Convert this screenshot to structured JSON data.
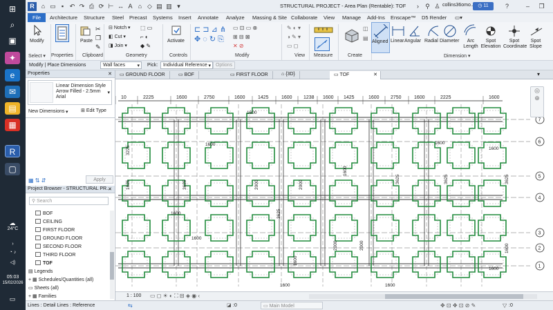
{
  "taskbar": {
    "weather_temp": "24°C",
    "clock_time": "05:03",
    "clock_date": "15/02/2026"
  },
  "title": {
    "window_title": "STRUCTURAL PROJECT - Area Plan (Rentable): TOF",
    "user": "collins36omo...",
    "timer": "11"
  },
  "menu": [
    "File",
    "Architecture",
    "Structure",
    "Steel",
    "Precast",
    "Systems",
    "Insert",
    "Annotate",
    "Analyze",
    "Massing & Site",
    "Collaborate",
    "View",
    "Manage",
    "Add-Ins",
    "Enscape™",
    "D5 Render"
  ],
  "ribbon": {
    "modify": "Modify",
    "paste": "Paste",
    "notch": "Notch",
    "cut": "Cut",
    "join": "Join",
    "activate": "Activate",
    "aligned": "Aligned",
    "linear": "Linear",
    "angular": "Angular",
    "radial": "Radial",
    "diameter": "Diameter",
    "arc_length": "Arc Length",
    "spot_elevation": "Spot Elevation",
    "spot_coordinate": "Spot Coordinate",
    "spot_slope": "Spot Slope",
    "groups": {
      "select": "Select",
      "properties": "Properties",
      "clipboard": "Clipboard",
      "geometry": "Geometry",
      "controls": "Controls",
      "modify": "Modify",
      "view": "View",
      "measure": "Measure",
      "create": "Create",
      "dimension": "Dimension"
    }
  },
  "options_bar": {
    "context": "Modify | Place Dimensions",
    "wall_faces": "Wall faces",
    "pick_label": "Pick:",
    "pick_value": "Individual Reference",
    "options_button": "Options"
  },
  "properties": {
    "header": "Properties",
    "type_name": "Linear Dimension Style Arrow Filled - 2.5mm Arial",
    "instance": "New Dimensions",
    "edit_type": "Edit Type",
    "apply": "Apply"
  },
  "project_browser": {
    "header": "Project Browser - STRUCTURAL PR...",
    "search_placeholder": "Search",
    "views": [
      "BOF",
      "CEILING",
      "FIRST FLOOR",
      "GROUND FLOOR",
      "SECOND FLOOR",
      "THIRD FLOOR",
      "TOF"
    ],
    "other": [
      "Legends",
      "Schedules/Quantities (all)",
      "Sheets (all)",
      "Families"
    ]
  },
  "view_tabs": [
    "GROUND FLOOR",
    "BOF",
    "FIRST FLOOR",
    "{3D}",
    "TOF"
  ],
  "drawing": {
    "top_dims": [
      "10",
      "2225",
      "1600",
      "2750",
      "1600",
      "1425",
      "1600",
      "1238",
      "1600",
      "1425",
      "1600",
      "2750",
      "1600",
      "2225",
      "1600"
    ],
    "gridlines": [
      "7",
      "6",
      "5",
      "4",
      "3",
      "2",
      "1"
    ],
    "inner_dims": [
      "1600",
      "1600",
      "3225",
      "1625",
      "3625",
      "2000",
      "2000",
      "1600",
      "1600",
      "1600",
      "3625",
      "3625",
      "3625",
      "1600",
      "1600",
      "1600",
      "3625",
      "1600",
      "2000",
      "2000",
      "1600",
      "1600",
      "1600"
    ]
  },
  "view_control": {
    "scale": "1 : 100"
  },
  "status": {
    "message": "Lines : Detail Lines : Reference",
    "workset": ":0",
    "model": "Main Model",
    "filter": ":0"
  },
  "colors": {
    "footing": "#1e8a3a",
    "beam": "#333333",
    "accent": "#2c6ec7"
  }
}
